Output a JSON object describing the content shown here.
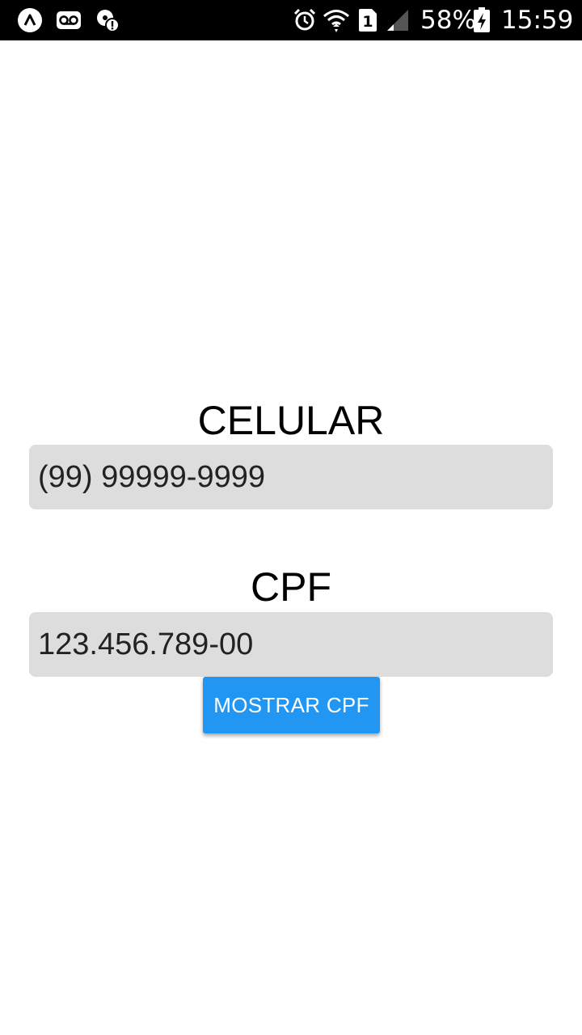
{
  "status_bar": {
    "battery_percent": "58%",
    "time": "15:59",
    "sim_slot": "1",
    "icons": [
      "expo-icon",
      "voicemail-icon",
      "notification-icon",
      "alarm-icon",
      "wifi-icon",
      "sim-icon",
      "signal-icon",
      "battery-charging-icon"
    ]
  },
  "form": {
    "celular_label": "CELULAR",
    "celular_value": "(99) 99999-9999",
    "cpf_label": "CPF",
    "cpf_value": "123.456.789-00",
    "show_cpf_button": "MOSTRAR CPF"
  },
  "colors": {
    "button": "#2196f3",
    "field_background": "#dddddd",
    "status_bar": "#000000"
  }
}
